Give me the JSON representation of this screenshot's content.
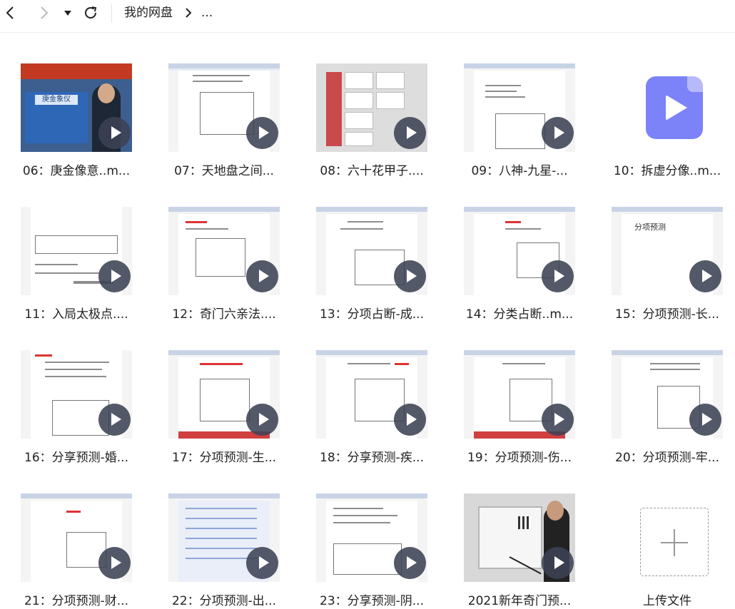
{
  "toolbar": {
    "back_icon": "chevron-left-icon",
    "forward_icon": "chevron-right-icon",
    "dropdown_icon": "caret-down-icon",
    "refresh_icon": "refresh-icon",
    "breadcrumb_root": "我的网盘",
    "breadcrumb_more": "..."
  },
  "files": [
    {
      "label": "06：庚金像意..m..."
    },
    {
      "label": "07：天地盘之间..."
    },
    {
      "label": "08：六十花甲子...."
    },
    {
      "label": "09：八神-九星-..."
    },
    {
      "label": "10：拆虚分像..m..."
    },
    {
      "label": "11：入局太极点...."
    },
    {
      "label": "12：奇门六亲法...."
    },
    {
      "label": "13：分项占断-成..."
    },
    {
      "label": "14：分类占断..m..."
    },
    {
      "label": "15：分项预测-长..."
    },
    {
      "label": "16：分享预测-婚..."
    },
    {
      "label": "17：分项预测-生..."
    },
    {
      "label": "18：分享预测-疾..."
    },
    {
      "label": "19：分项预测-伤..."
    },
    {
      "label": "20：分项预测-牢..."
    },
    {
      "label": "21：分项预测-财..."
    },
    {
      "label": "22：分项预测-出..."
    },
    {
      "label": "23：分享预测-阴..."
    },
    {
      "label": "2021新年奇门预..."
    }
  ],
  "thumb_text": {
    "lecture_card": "庚金象仪",
    "doc15": "分项预测"
  },
  "upload": {
    "label": "上传文件"
  },
  "colors": {
    "accent_video_icon": "#7c82f7",
    "play_button": "#3c4254"
  }
}
